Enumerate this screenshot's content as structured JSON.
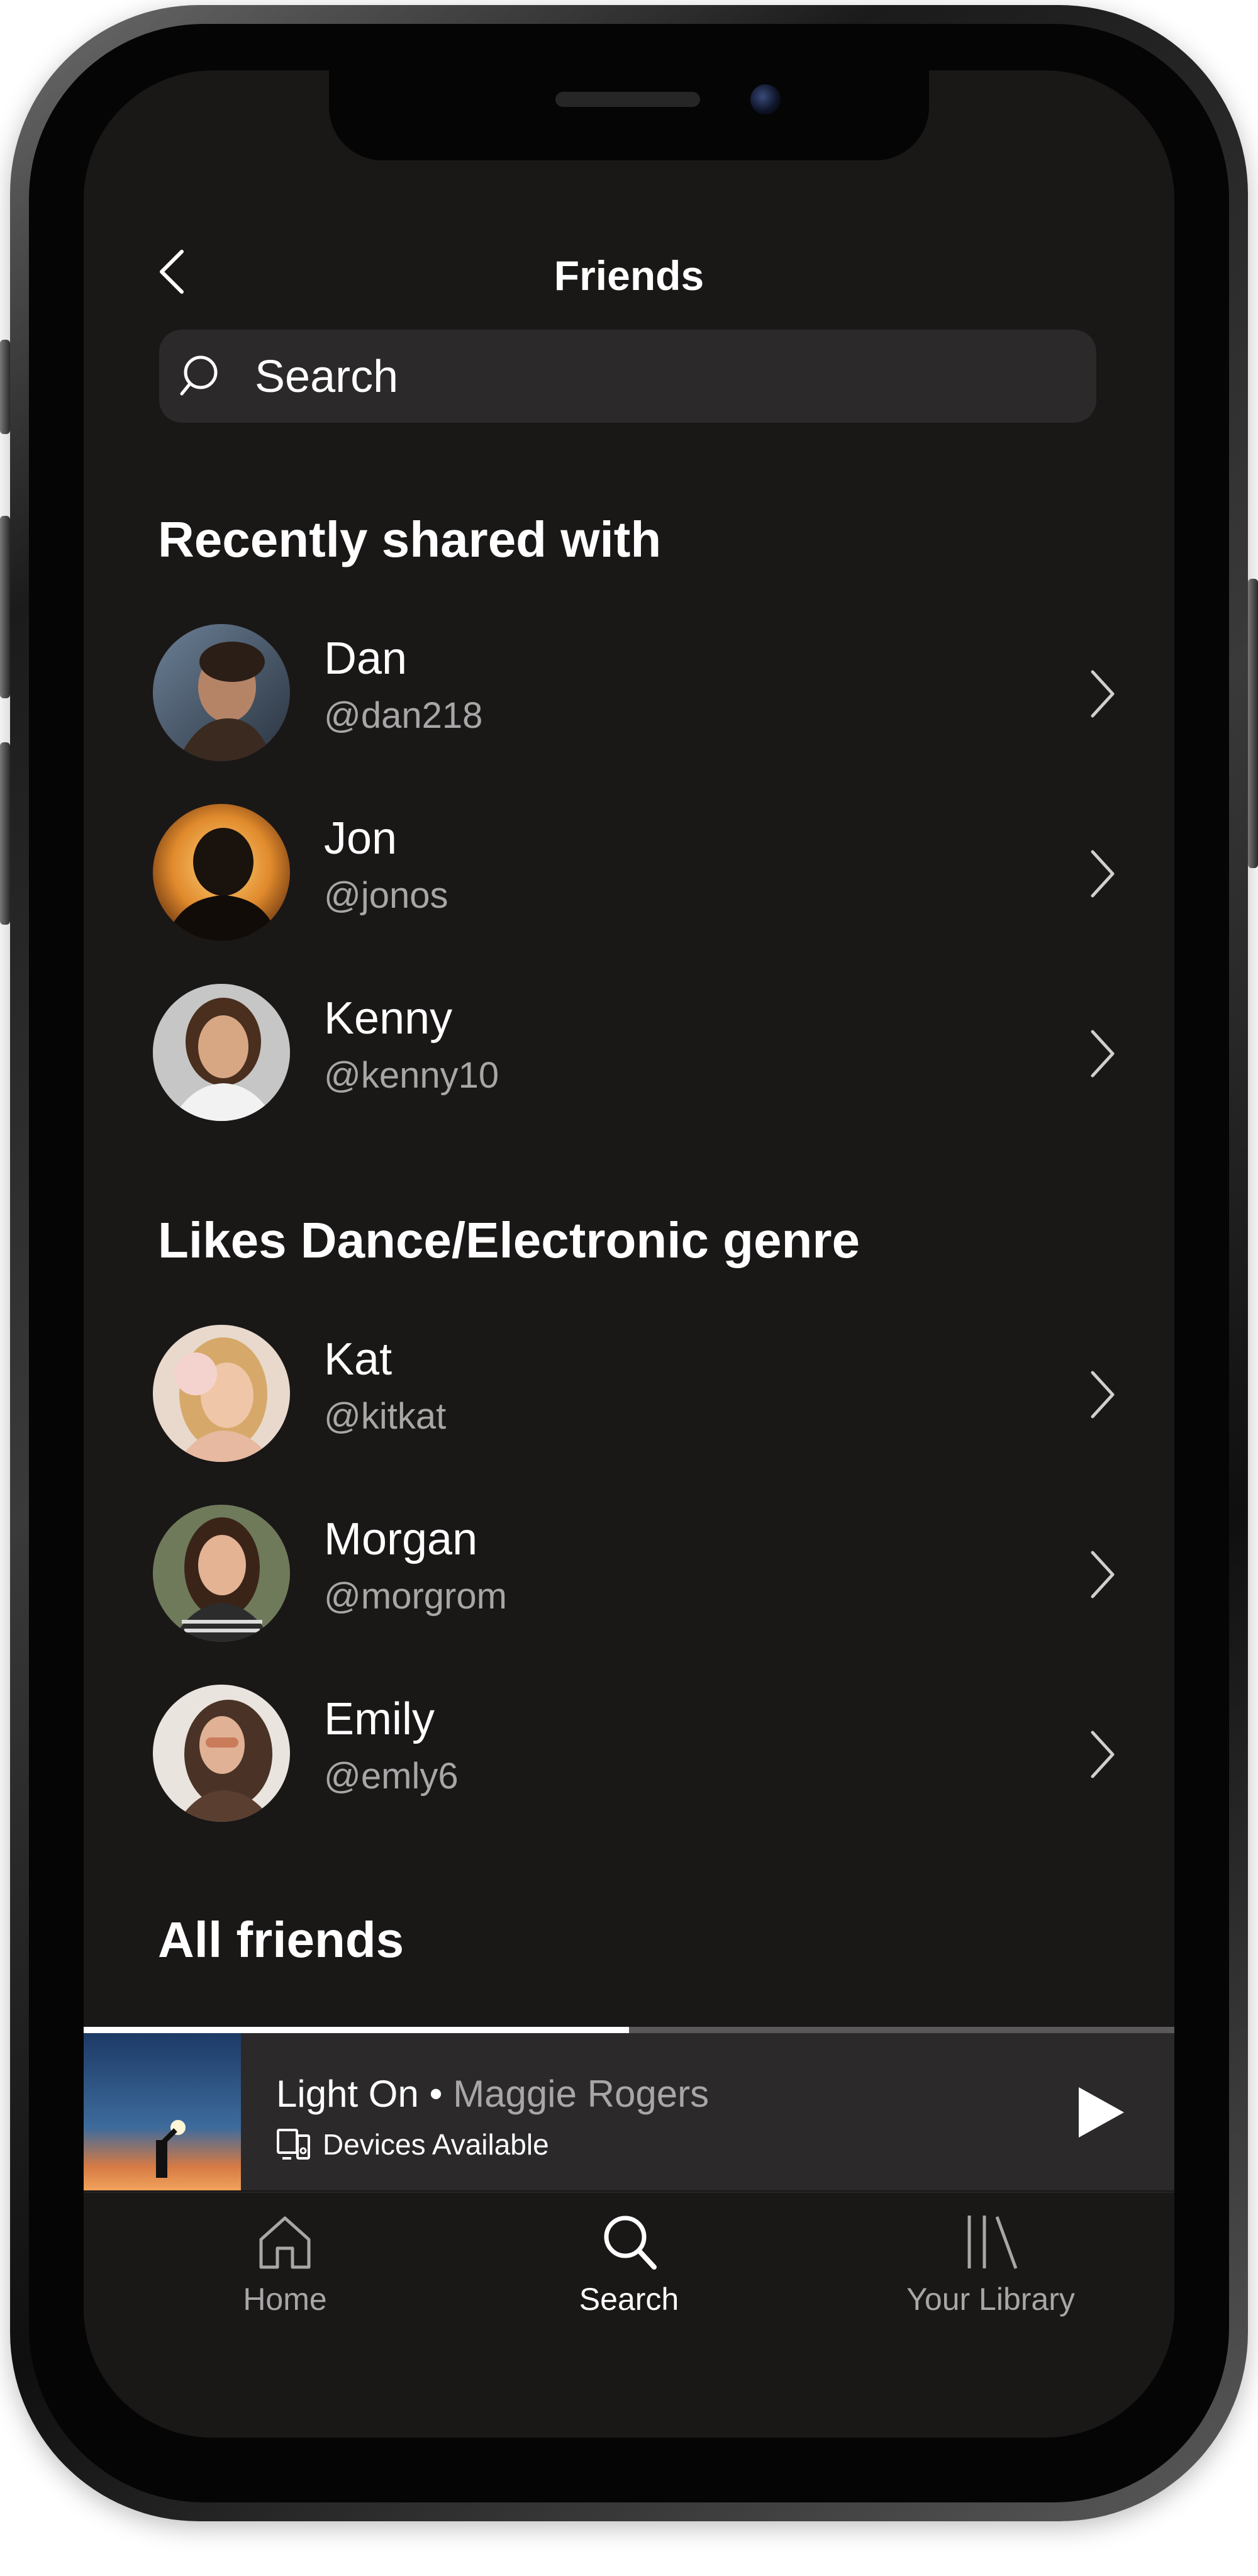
{
  "header": {
    "title": "Friends",
    "back_icon": "chevron-left-icon"
  },
  "search": {
    "placeholder": "Search",
    "icon": "search-icon"
  },
  "sections": [
    {
      "heading": "Recently shared with",
      "friends": [
        {
          "name": "Dan",
          "handle": "@dan218"
        },
        {
          "name": "Jon",
          "handle": "@jonos"
        },
        {
          "name": "Kenny",
          "handle": "@kenny10"
        }
      ]
    },
    {
      "heading": "Likes Dance/Electronic genre",
      "friends": [
        {
          "name": "Kat",
          "handle": "@kitkat"
        },
        {
          "name": "Morgan",
          "handle": "@morgrom"
        },
        {
          "name": "Emily",
          "handle": "@emly6"
        }
      ]
    },
    {
      "heading": "All friends",
      "friends": []
    }
  ],
  "now_playing": {
    "song": "Light On",
    "separator": "•",
    "artist": "Maggie Rogers",
    "devices_label": "Devices Available",
    "progress": 0.5,
    "play_icon": "play-icon",
    "devices_icon": "devices-icon"
  },
  "tab_bar": {
    "tabs": [
      {
        "label": "Home",
        "icon": "home-icon",
        "active": false
      },
      {
        "label": "Search",
        "icon": "search-icon",
        "active": true
      },
      {
        "label": "Your Library",
        "icon": "library-icon",
        "active": false
      }
    ]
  },
  "colors": {
    "background": "#1a1717",
    "text_primary": "#ffffff",
    "text_secondary": "#a8a6a6",
    "surface": "#2b2929"
  }
}
